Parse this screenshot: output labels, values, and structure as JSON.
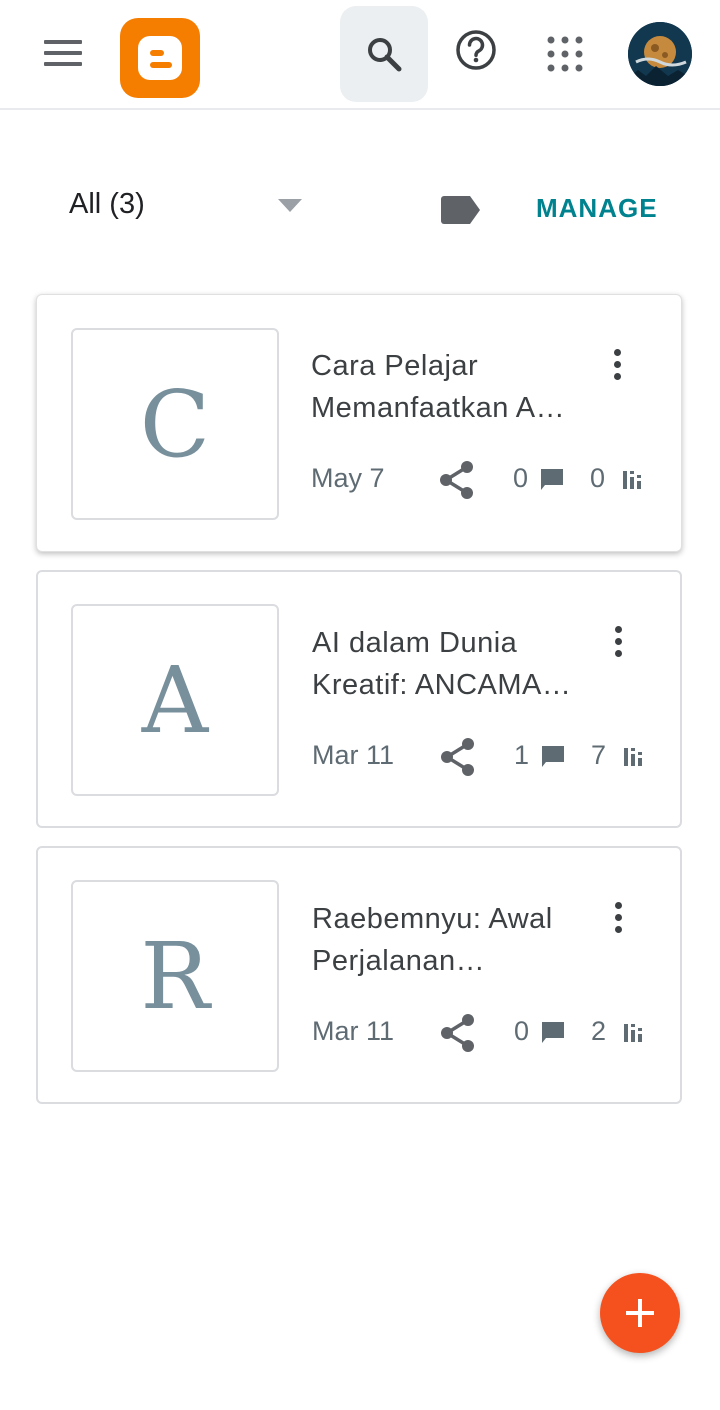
{
  "header": {
    "menu_icon": "hamburger-menu-icon",
    "logo_icon": "blogger-logo-icon",
    "search_icon": "search-icon",
    "help_icon": "help-circle-icon",
    "apps_icon": "apps-grid-icon",
    "avatar_icon": "profile-avatar-icon"
  },
  "filter": {
    "label": "All (3)",
    "dropdown_icon": "caret-down-icon",
    "label_icon": "label-tag-icon",
    "manage_label": "MANAGE"
  },
  "posts": [
    {
      "letter": "C",
      "title_line1": "Cara Pelajar",
      "title_line2": "Memanfaatkan A…",
      "date": "May 7",
      "comments": "0",
      "views": "0"
    },
    {
      "letter": "A",
      "title_line1": "AI dalam Dunia",
      "title_line2": "Kreatif: ANCAMA…",
      "date": "Mar 11",
      "comments": "1",
      "views": "7"
    },
    {
      "letter": "R",
      "title_line1": "Raebemnyu: Awal",
      "title_line2": "Perjalanan…",
      "date": "Mar 11",
      "comments": "0",
      "views": "2"
    }
  ],
  "fab": {
    "icon": "add-plus-icon"
  },
  "colors": {
    "brand_orange": "#f57d00",
    "accent_teal": "#00838f",
    "fab_red": "#f4511e"
  }
}
